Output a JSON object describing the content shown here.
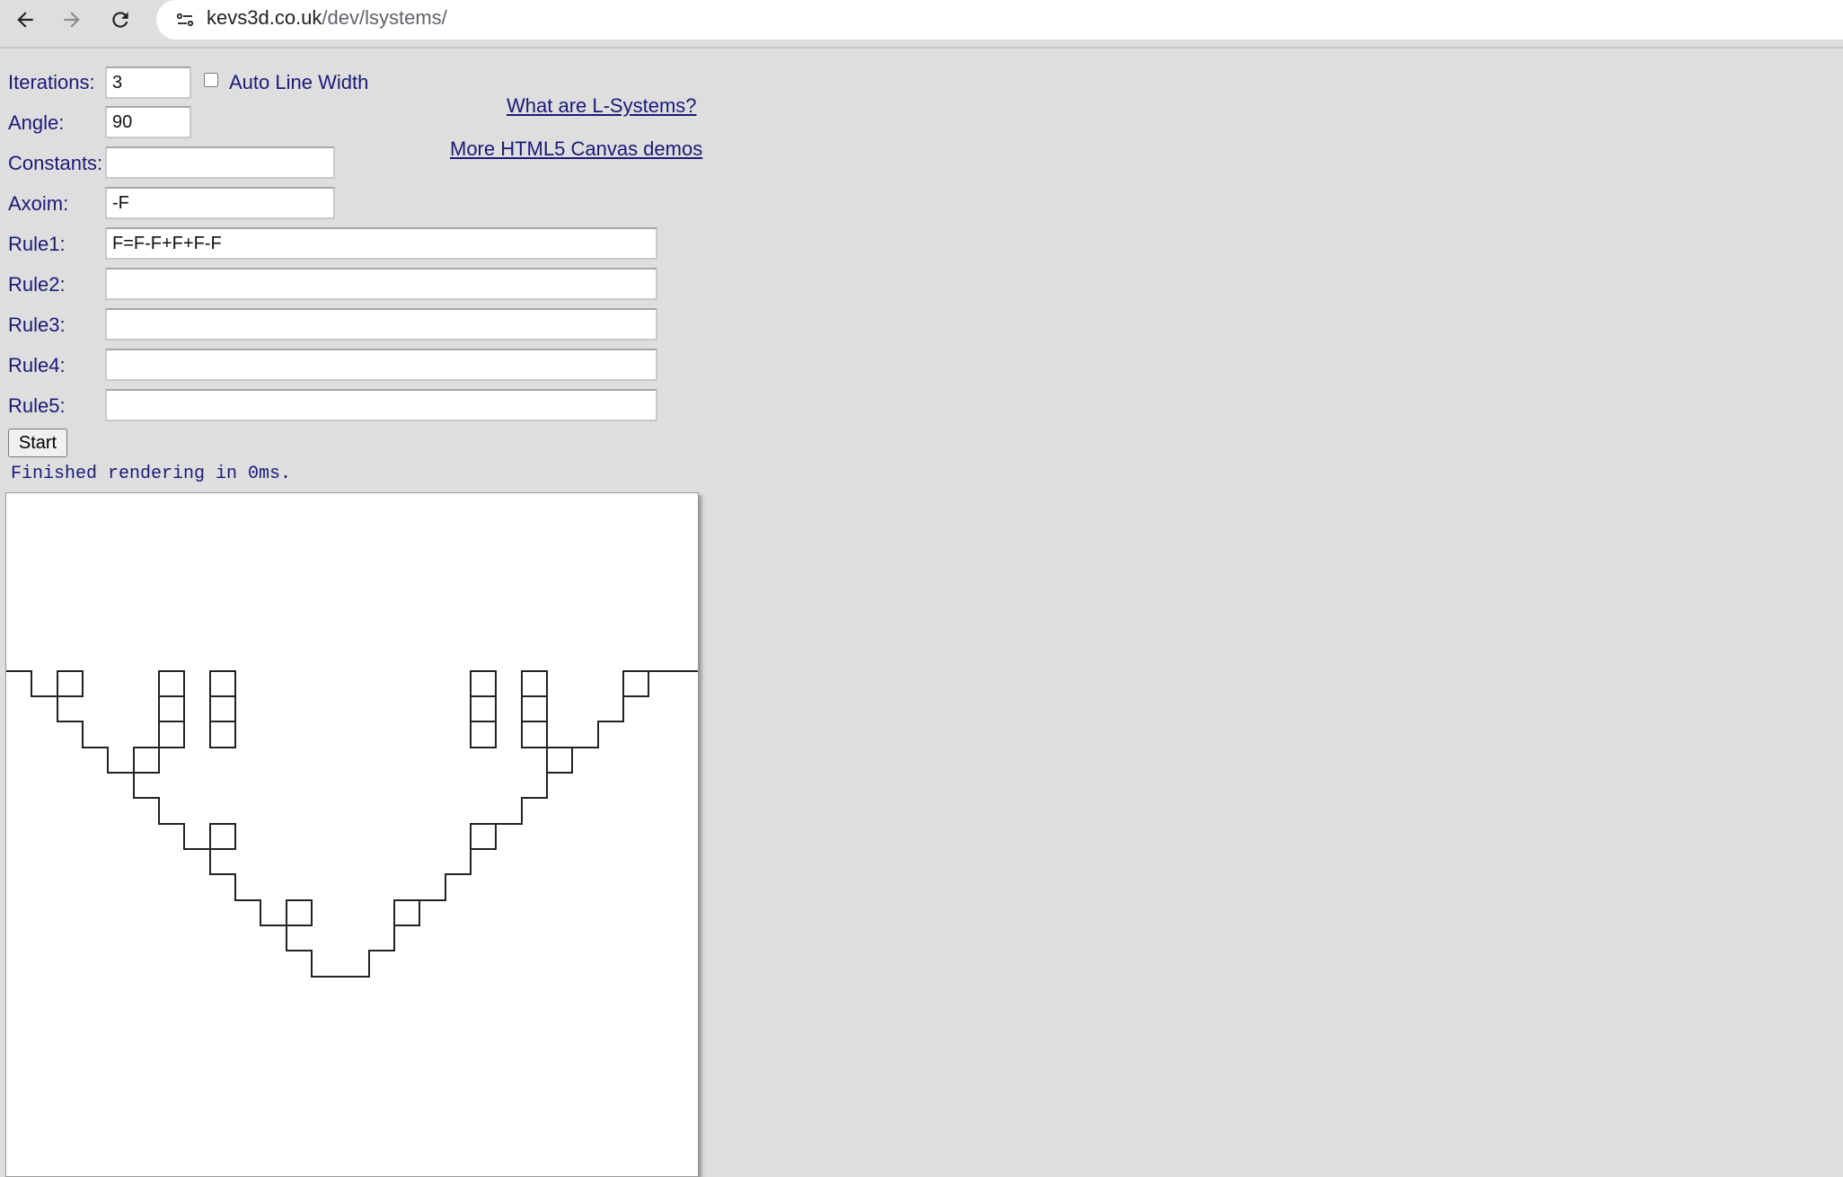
{
  "browser": {
    "url_host": "kevs3d.co.uk",
    "url_path": "/dev/lsystems/"
  },
  "form": {
    "iterations_label": "Iterations:",
    "iterations_value": "3",
    "auto_line_width_label": "Auto Line Width",
    "auto_line_width_checked": false,
    "angle_label": "Angle:",
    "angle_value": "90",
    "constants_label": "Constants:",
    "constants_value": "",
    "axiom_label": "Axoim:",
    "axiom_value": "-F",
    "rule1_label": "Rule1:",
    "rule1_value": "F=F-F+F+F-F",
    "rule2_label": "Rule2:",
    "rule2_value": "",
    "rule3_label": "Rule3:",
    "rule3_value": "",
    "rule4_label": "Rule4:",
    "rule4_value": "",
    "rule5_label": "Rule5:",
    "rule5_value": "",
    "start_label": "Start"
  },
  "links": {
    "what_are": "What are L-Systems?",
    "more_demos": "More HTML5 Canvas demos"
  },
  "status": "Finished rendering in 0ms.",
  "colors": {
    "page_bg": "#dedede",
    "label_text": "#1a1a7a",
    "stroke": "#222222"
  }
}
